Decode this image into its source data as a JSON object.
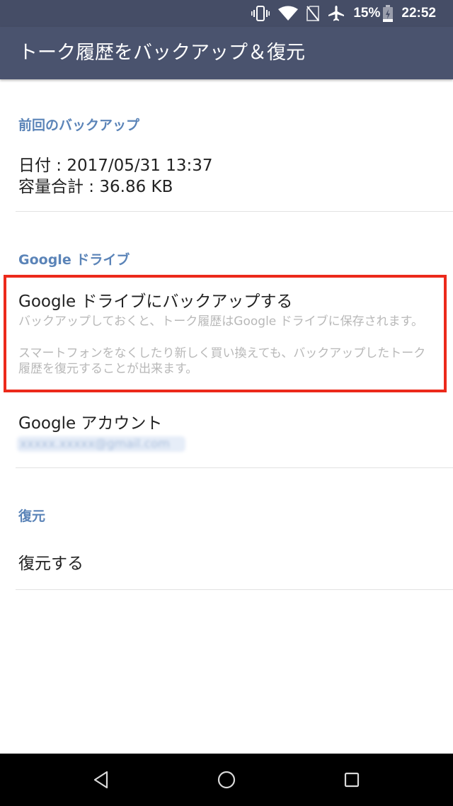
{
  "status_bar": {
    "battery": "15%",
    "time": "22:52",
    "icons": [
      "vibrate-icon",
      "wifi-icon",
      "no-sim-icon",
      "airplane-icon",
      "battery-icon"
    ]
  },
  "app_bar": {
    "title": "トーク履歴をバックアップ＆復元"
  },
  "sections": {
    "last_backup": {
      "header": "前回のバックアップ",
      "date_line": "日付 : 2017/05/31 13:37",
      "size_line": "容量合計 : 36.86 KB"
    },
    "google_drive": {
      "header": "Google ドライブ",
      "backup_item": {
        "title": "Google ドライブにバックアップする",
        "description_1": "バックアップしておくと、トーク履歴はGoogle ドライブに保存されます。",
        "description_2": "スマートフォンをなくしたり新しく買い換えても、バックアップしたトーク履歴を復元することが出来ます。"
      },
      "account_item": {
        "title": "Google アカウント",
        "email": "xxxxx.xxxxx@gmail.com"
      }
    },
    "restore": {
      "header": "復元",
      "restore_item": "復元する"
    }
  },
  "colors": {
    "status_bar": "#454d66",
    "app_bar": "#4a536e",
    "section_header": "#5b84b8",
    "highlight": "#ec2a1b"
  },
  "nav_bar": {
    "icons": [
      "back-icon",
      "home-icon",
      "recents-icon"
    ]
  }
}
